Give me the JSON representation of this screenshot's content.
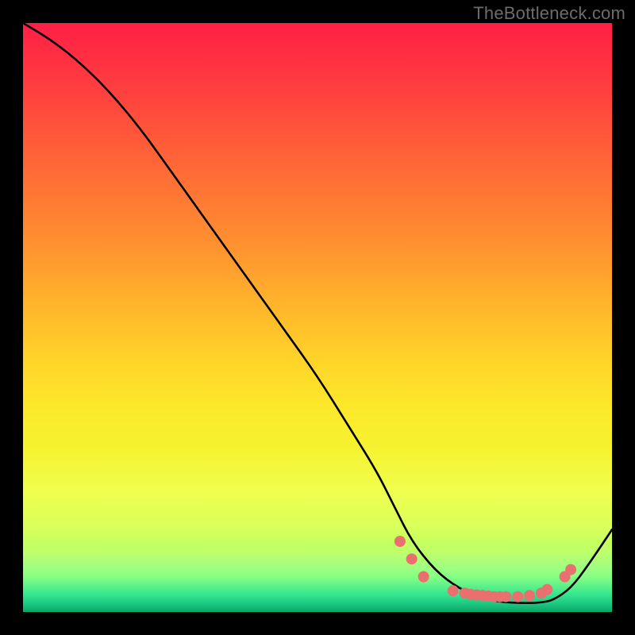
{
  "watermark": "TheBottleneck.com",
  "chart_data": {
    "type": "line",
    "title": "",
    "xlabel": "",
    "ylabel": "",
    "xlim": [
      0,
      100
    ],
    "ylim": [
      0,
      100
    ],
    "series": [
      {
        "name": "curve",
        "x": [
          0,
          5,
          10,
          15,
          20,
          25,
          30,
          35,
          40,
          45,
          50,
          55,
          60,
          63,
          66,
          70,
          74,
          78,
          82,
          86,
          88,
          90,
          93,
          96,
          100
        ],
        "y": [
          100,
          97,
          93,
          88,
          82,
          75,
          68,
          61,
          54,
          47,
          40,
          32,
          24,
          18,
          12,
          7,
          4,
          2.2,
          1.6,
          1.5,
          1.6,
          2.0,
          4,
          8,
          14
        ]
      }
    ],
    "markers": [
      {
        "x": 64,
        "y": 12
      },
      {
        "x": 66,
        "y": 9
      },
      {
        "x": 68,
        "y": 6
      },
      {
        "x": 73,
        "y": 3.6
      },
      {
        "x": 75,
        "y": 3.2
      },
      {
        "x": 76,
        "y": 3.0
      },
      {
        "x": 77,
        "y": 2.9
      },
      {
        "x": 78,
        "y": 2.8
      },
      {
        "x": 79,
        "y": 2.7
      },
      {
        "x": 80,
        "y": 2.6
      },
      {
        "x": 81,
        "y": 2.6
      },
      {
        "x": 82,
        "y": 2.6
      },
      {
        "x": 84,
        "y": 2.6
      },
      {
        "x": 86,
        "y": 2.8
      },
      {
        "x": 88,
        "y": 3.2
      },
      {
        "x": 89,
        "y": 3.8
      },
      {
        "x": 92,
        "y": 6
      },
      {
        "x": 93,
        "y": 7.2
      }
    ],
    "colors": {
      "line": "#000000",
      "marker": "#e9706f"
    }
  }
}
